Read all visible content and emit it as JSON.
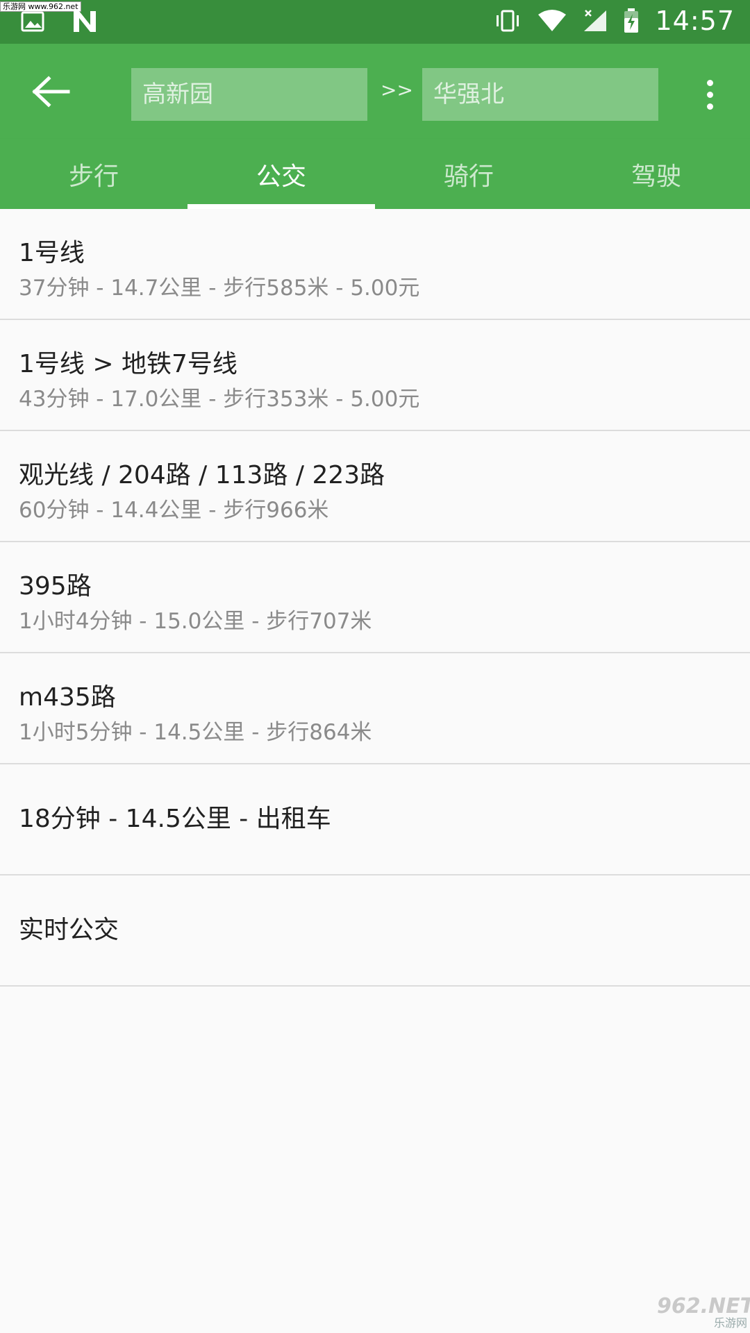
{
  "status_bar": {
    "time": "14:57",
    "watermark": "乐游网 www.962.net"
  },
  "toolbar": {
    "from_value": "高新园",
    "separator": ">>",
    "to_value": "华强北"
  },
  "tabs": [
    {
      "label": "步行",
      "active": false
    },
    {
      "label": "公交",
      "active": true
    },
    {
      "label": "骑行",
      "active": false
    },
    {
      "label": "驾驶",
      "active": false
    }
  ],
  "routes": [
    {
      "title": "1号线",
      "detail": "37分钟 - 14.7公里 - 步行585米 - 5.00元"
    },
    {
      "title": "1号线 > 地铁7号线",
      "detail": "43分钟 - 17.0公里 - 步行353米 - 5.00元"
    },
    {
      "title": "观光线 / 204路 / 113路 / 223路",
      "detail": "60分钟 - 14.4公里 - 步行966米"
    },
    {
      "title": "395路",
      "detail": "1小时4分钟 - 15.0公里 - 步行707米"
    },
    {
      "title": "m435路",
      "detail": "1小时5分钟 - 14.5公里 - 步行864米"
    },
    {
      "title": "18分钟 - 14.5公里 - 出租车"
    },
    {
      "title": "实时公交"
    }
  ],
  "watermark_bottom": {
    "logo": "962.NET",
    "text": "乐游网"
  }
}
